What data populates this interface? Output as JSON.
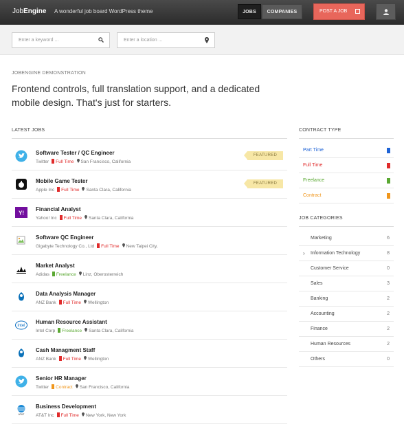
{
  "header": {
    "logo_part1": "Job",
    "logo_part2": "Engine",
    "tagline": "A wonderful job board WordPress theme",
    "nav": [
      "JOBS",
      "COMPANIES"
    ],
    "post_job": "POST A JOB"
  },
  "search": {
    "keyword_placeholder": "Enter a keyword ...",
    "location_placeholder": "Enter a location ..."
  },
  "intro": {
    "label": "JOBENGINE DEMONSTRATION",
    "headline": "Frontend controls, full translation support, and a dedicated mobile design. That's just for starters."
  },
  "latest_jobs": {
    "heading": "LATEST JOBS",
    "featured_label": "FEATURED",
    "items": [
      {
        "title": "Software Tester / QC Engineer",
        "company": "Twitter",
        "type": "Full Time",
        "location": "San Francisco, California",
        "featured": true,
        "logo": "twitter-logo-icon"
      },
      {
        "title": "Mobile Game Tester",
        "company": "Apple Inc",
        "type": "Full Time",
        "location": "Santa Clara, California",
        "featured": true,
        "logo": "apple-logo-icon"
      },
      {
        "title": "Financial Analyst",
        "company": "Yahoo! Inc",
        "type": "Full Time",
        "location": "Santa Clara, California",
        "featured": false,
        "logo": "yahoo-logo-icon"
      },
      {
        "title": "Software QC Engineer",
        "company": "Gigabyte Technology Co., Ltd",
        "type": "Full Time",
        "location": "New Taipei City,",
        "featured": false,
        "logo": "broken-image-icon"
      },
      {
        "title": "Market Analyst",
        "company": "Adidas",
        "type": "Freelance",
        "location": "Linz, Oberosterreich",
        "featured": false,
        "logo": "adidas-logo-icon"
      },
      {
        "title": "Data Analysis Manager",
        "company": "ANZ Bank",
        "type": "Full Time",
        "location": "Wellington",
        "featured": false,
        "logo": "anz-logo-icon"
      },
      {
        "title": "Human Resource Assistant",
        "company": "Intel Corp",
        "type": "Freelance",
        "location": "Santa Clara, California",
        "featured": false,
        "logo": "intel-logo-icon"
      },
      {
        "title": "Cash Managment Staff",
        "company": "ANZ Bank",
        "type": "Full Time",
        "location": "Wellington",
        "featured": false,
        "logo": "anz-logo-icon"
      },
      {
        "title": "Senior HR Manager",
        "company": "Twitter",
        "type": "Contract",
        "location": "San Francisco, California",
        "featured": false,
        "logo": "twitter-logo-icon"
      },
      {
        "title": "Business Development",
        "company": "AT&T Inc",
        "type": "Full Time",
        "location": "New York, New York",
        "featured": false,
        "logo": "att-logo-icon"
      }
    ]
  },
  "contract_types": {
    "heading": "CONTRACT TYPE",
    "items": [
      {
        "label": "Part Time",
        "color": "#1e63d6"
      },
      {
        "label": "Full Time",
        "color": "#e02b2b"
      },
      {
        "label": "Freelance",
        "color": "#5aa832"
      },
      {
        "label": "Contract",
        "color": "#f0961b"
      }
    ]
  },
  "job_categories": {
    "heading": "JOB CATEGORIES",
    "items": [
      {
        "label": "Marketing",
        "count": "6",
        "expanded": false
      },
      {
        "label": "Information Technology",
        "count": "8",
        "expanded": true
      },
      {
        "label": "Customer Service",
        "count": "0",
        "expanded": false
      },
      {
        "label": "Sales",
        "count": "3",
        "expanded": false
      },
      {
        "label": "Banking",
        "count": "2",
        "expanded": false
      },
      {
        "label": "Accounting",
        "count": "2",
        "expanded": false
      },
      {
        "label": "Finance",
        "count": "2",
        "expanded": false
      },
      {
        "label": "Human Resources",
        "count": "2",
        "expanded": false
      },
      {
        "label": "Others",
        "count": "0",
        "expanded": false
      }
    ]
  },
  "type_colors": {
    "Part Time": "#1e63d6",
    "Full Time": "#e02b2b",
    "Freelance": "#5aa832",
    "Contract": "#f0961b"
  }
}
